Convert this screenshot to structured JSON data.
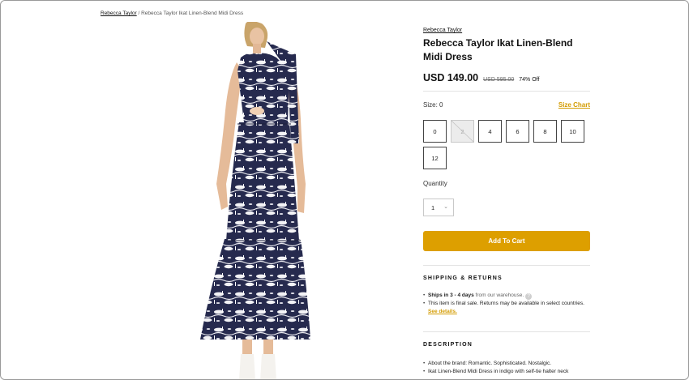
{
  "breadcrumb": {
    "brand": "Rebecca Taylor",
    "separator": " / ",
    "current": "Rebecca Taylor Ikat Linen-Blend Midi Dress"
  },
  "product": {
    "brand": "Rebecca Taylor",
    "title": "Rebecca Taylor Ikat Linen-Blend Midi Dress",
    "price": "USD 149.00",
    "compare_price": "USD 595.00",
    "discount": "74% Off",
    "image_alt": "Rebecca Taylor Ikat Linen-Blend Midi Dress"
  },
  "size": {
    "label": "Size: 0",
    "chart_label": "Size Chart",
    "options": [
      {
        "label": "0",
        "available": true,
        "selected": true
      },
      {
        "label": "2",
        "available": false,
        "selected": false
      },
      {
        "label": "4",
        "available": true,
        "selected": false
      },
      {
        "label": "6",
        "available": true,
        "selected": false
      },
      {
        "label": "8",
        "available": true,
        "selected": false
      },
      {
        "label": "10",
        "available": true,
        "selected": false
      },
      {
        "label": "12",
        "available": true,
        "selected": false
      }
    ]
  },
  "quantity": {
    "label": "Quantity",
    "value": "1"
  },
  "cart": {
    "button_label": "Add To Cart"
  },
  "shipping": {
    "title": "SHIPPING & RETURNS",
    "ships_bold": "Ships in 3 - 4 days",
    "ships_rest": " from our warehouse.",
    "final_sale": "This item is final sale. Returns may be available in select countries.",
    "see_details": "See details."
  },
  "description": {
    "title": "DESCRIPTION",
    "items": [
      "About the brand: Romantic. Sophisticated. Nostalgic.",
      "Ikat Linen-Blend Midi Dress in indigo with self-tie halter neck"
    ]
  },
  "colors": {
    "accent": "#dd9f00",
    "accent_text": "#d39b00",
    "dress_navy": "#262a4e"
  },
  "icons": {
    "help": "question-circle-icon",
    "chevron": "chevron-down-icon"
  }
}
